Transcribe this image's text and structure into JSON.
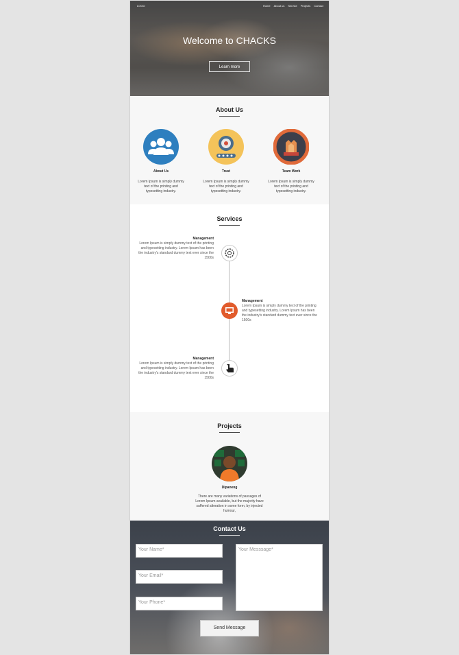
{
  "header": {
    "logo": "LOGO",
    "nav": [
      "Home",
      "About us",
      "Service",
      "Projects",
      "Contact"
    ]
  },
  "hero": {
    "title": "Welcome to CHACKS",
    "button": "Learn more"
  },
  "about": {
    "title": "About Us",
    "items": [
      {
        "name": "About Us",
        "icon": "team-icon",
        "desc": "Lorem Ipsum is simply dummy text of the printing and typesetting industry."
      },
      {
        "name": "Trust",
        "icon": "gear-conveyor-icon",
        "desc": "Lorem Ipsum is simply dummy text of the printing and typesetting industry."
      },
      {
        "name": "Team Work",
        "icon": "hands-together-icon",
        "desc": "Lorem Ipsum is simply dummy text of the printing and typesetting industry."
      }
    ]
  },
  "services": {
    "title": "Services",
    "items": [
      {
        "title": "Management",
        "icon": "gear-icon",
        "desc": "Lorem Ipsum is simply dummy text of the printing and typesetting industry. Lorem Ipsum has been the industry's standard dummy text ever since the 1500s"
      },
      {
        "title": "Management",
        "icon": "monitor-icon",
        "desc": "Lorem Ipsum is simply dummy text of the printing and typesetting industry. Lorem Ipsum has been the industry's standard dummy text ever since the 1500s"
      },
      {
        "title": "Management",
        "icon": "hand-pointer-icon",
        "desc": "Lorem Ipsum is simply dummy text of the printing and typesetting industry. Lorem Ipsum has been the industry's standard dummy text ever since the 1500s"
      }
    ]
  },
  "projects": {
    "title": "Projects",
    "item": {
      "name": "Dipaneng",
      "desc": "There are many variations of passages of Lorem Ipsum available, but the majority have suffered alteration in some form, by injected humour,"
    }
  },
  "contact": {
    "title": "Contact Us",
    "name_placeholder": "Your Name*",
    "email_placeholder": "Your Email*",
    "phone_placeholder": "Your Phone*",
    "message_placeholder": "Your Messsage*",
    "send": "Send Message"
  }
}
